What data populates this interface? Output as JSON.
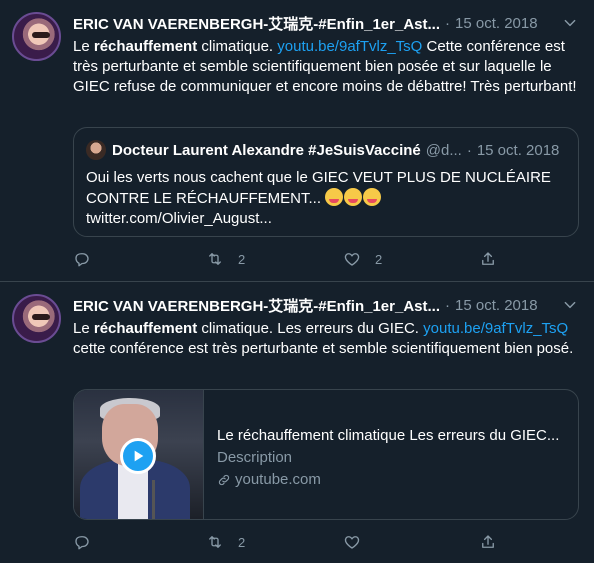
{
  "tweets": [
    {
      "author": "ERIC VAN VAERENBERGH-艾瑞克-#Enfin_1er_Ast...",
      "separator": "·",
      "date": "15 oct. 2018",
      "text_parts": {
        "p1": "Le ",
        "p2": "réchauffement",
        "p3": " climatique. ",
        "link": "youtu.be/9afTvlz_TsQ",
        "p4": " Cette conférence est très perturbante et semble scientifiquement bien posée et sur laquelle le GIEC refuse de communiquer et encore moins de débattre! Très perturbant!"
      },
      "quote": {
        "author": "Docteur Laurent Alexandre #JeSuisVacciné",
        "handle": "@d...",
        "separator": "·",
        "date": "15 oct. 2018",
        "text": "Oui les verts nous cachent que le GIEC VEUT PLUS DE NUCLÉAIRE CONTRE LE RÉCHAUFFEMENT...",
        "link": "twitter.com/Olivier_August..."
      },
      "actions": {
        "reply_count": "",
        "retweet_count": "2",
        "like_count": "2"
      }
    },
    {
      "author": "ERIC VAN VAERENBERGH-艾瑞克-#Enfin_1er_Ast...",
      "separator": "·",
      "date": "15 oct. 2018",
      "text_parts": {
        "p1": "Le ",
        "p2": "réchauffement",
        "p3": " climatique. Les erreurs du GIEC. ",
        "link": "youtu.be/9afTvlz_TsQ",
        "p4": " cette conférence est très perturbante et semble scientifiquement bien posé."
      },
      "card": {
        "title": "Le réchauffement climatique Les erreurs du GIEC...",
        "description": "Description",
        "domain": "youtube.com"
      },
      "actions": {
        "reply_count": "",
        "retweet_count": "2",
        "like_count": ""
      }
    }
  ],
  "colors": {
    "background": "#15202b",
    "border": "#38444d",
    "muted": "#8899a6",
    "link": "#1da1f2"
  },
  "icons": [
    "avatar",
    "chevron-down-icon",
    "reply-icon",
    "retweet-icon",
    "like-icon",
    "share-icon",
    "play-icon",
    "link-icon",
    "grinning-emoji-icon"
  ]
}
